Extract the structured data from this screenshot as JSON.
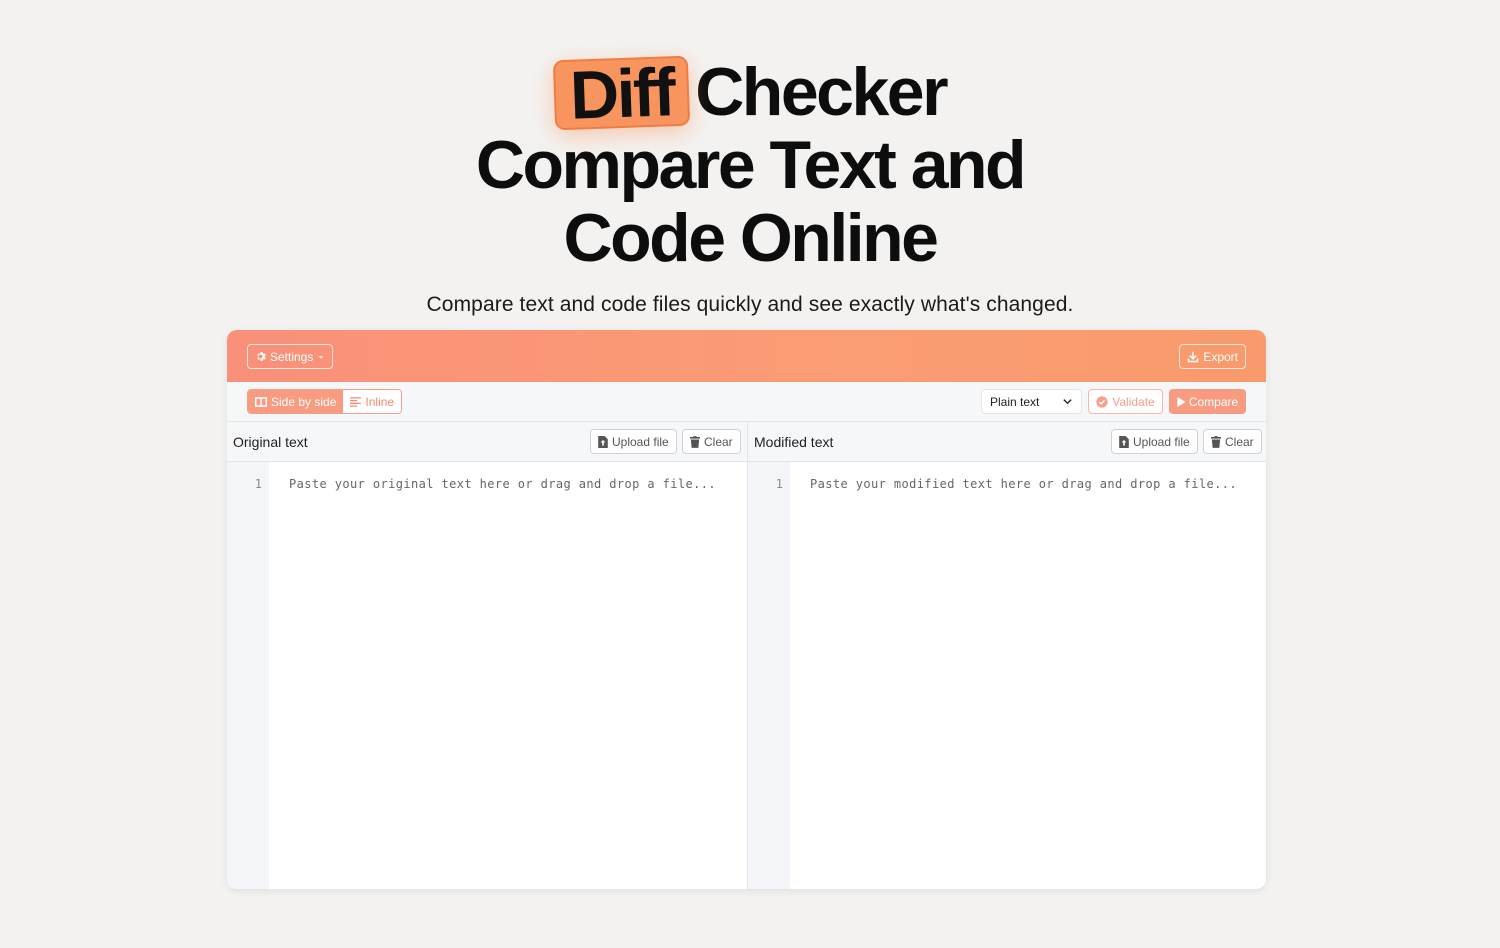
{
  "hero": {
    "badge": "Diff",
    "title_line1_rest": "Checker",
    "title_line2": "Compare Text and",
    "title_line3": "Code Online",
    "subtitle": "Compare text and code files quickly and see exactly what's changed."
  },
  "topbar": {
    "settings_label": "Settings",
    "export_label": "Export"
  },
  "toolbar": {
    "view_modes": [
      {
        "label": "Side by side",
        "icon": "columns-icon",
        "active": true
      },
      {
        "label": "Inline",
        "icon": "lines-icon",
        "active": false
      }
    ],
    "language_selected": "Plain text",
    "validate_label": "Validate",
    "compare_label": "Compare"
  },
  "panes": {
    "original": {
      "title": "Original text",
      "upload_label": "Upload file",
      "clear_label": "Clear",
      "line_number": "1",
      "placeholder": "Paste your original text here or drag and drop a file..."
    },
    "modified": {
      "title": "Modified text",
      "upload_label": "Upload file",
      "clear_label": "Clear",
      "line_number": "1",
      "placeholder": "Paste your modified text here or drag and drop a file..."
    }
  },
  "colors": {
    "accent": "#f89b80",
    "badge": "#f8955f",
    "background": "#f3f2f0"
  }
}
